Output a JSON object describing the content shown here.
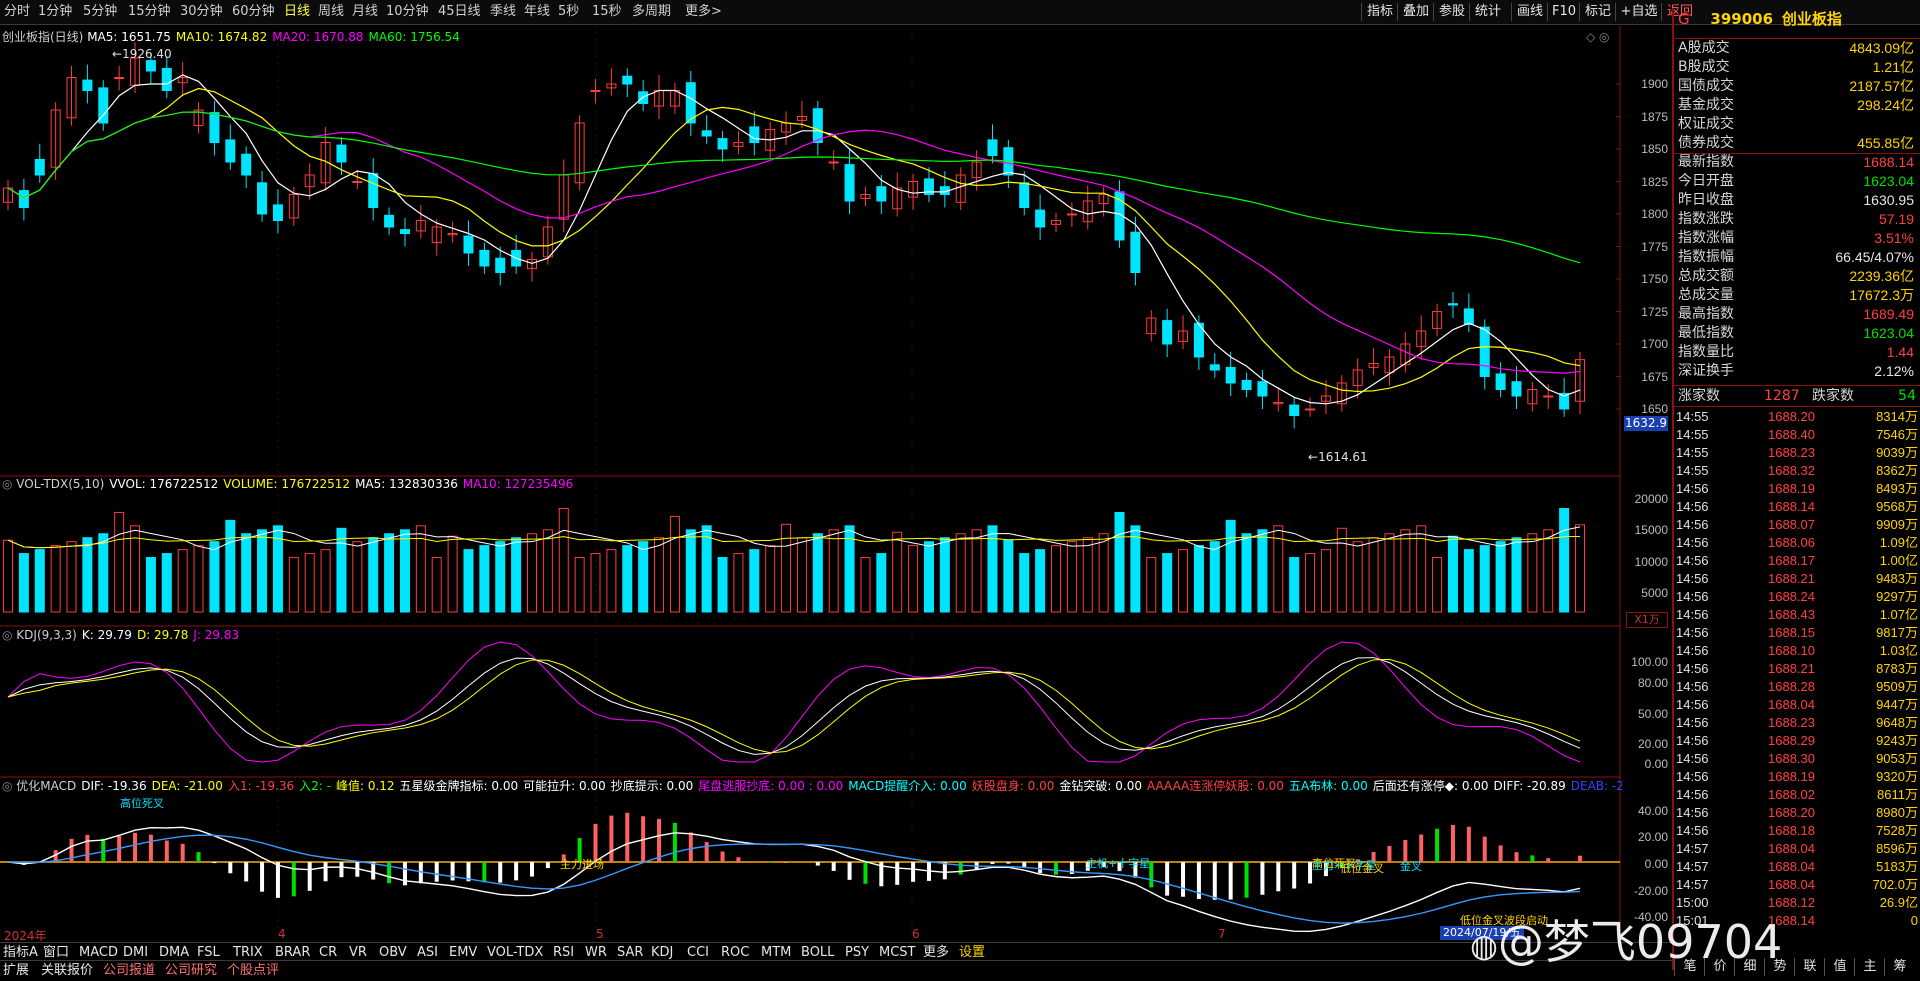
{
  "top_bar": {
    "timeframes": [
      "分时",
      "1分钟",
      "5分钟",
      "15分钟",
      "30分钟",
      "60分钟",
      "日线",
      "周线",
      "月线",
      "10分钟",
      "45日线",
      "季线",
      "年线",
      "5秒",
      "15秒",
      "多周期",
      "更多>"
    ],
    "active": "日线",
    "right_buttons": [
      "指标",
      "叠加",
      "参股",
      "统计",
      "画线",
      "F10",
      "标记",
      "+自选",
      "返回"
    ]
  },
  "main_panel": {
    "title": "创业板指(日线)",
    "ma_legend": [
      {
        "label": "MA5: 1651.75",
        "color": "#ffffff"
      },
      {
        "label": "MA10: 1674.82",
        "color": "#ffff00"
      },
      {
        "label": "MA20: 1670.88",
        "color": "#ff00ff"
      },
      {
        "label": "MA60: 1756.54",
        "color": "#00ff00"
      }
    ],
    "high_label": "1926.40",
    "low_label": "1614.61",
    "current_price_tag": "1632.9",
    "y_ticks": [
      "1900",
      "1875",
      "1850",
      "1825",
      "1800",
      "1775",
      "1750",
      "1725",
      "1700",
      "1675",
      "1650"
    ],
    "y_tick_values": [
      1900,
      1875,
      1850,
      1825,
      1800,
      1775,
      1750,
      1725,
      1700,
      1675,
      1650
    ]
  },
  "vol_panel": {
    "legend": [
      {
        "label": "VOL-TDX(5,10)",
        "color": "#cfcfcf"
      },
      {
        "label": "VVOL: 176722512",
        "color": "#ffffff"
      },
      {
        "label": "VOLUME: 176722512",
        "color": "#ffff00"
      },
      {
        "label": "MA5: 132830336",
        "color": "#ffffff"
      },
      {
        "label": "MA10: 127235496",
        "color": "#ff00ff"
      }
    ],
    "y_ticks": [
      "20000",
      "15000",
      "10000",
      "5000"
    ],
    "unit": "X1万"
  },
  "kdj_panel": {
    "legend": [
      {
        "label": "KDJ(9,3,3)",
        "color": "#cfcfcf"
      },
      {
        "label": "K: 29.79",
        "color": "#ffffff"
      },
      {
        "label": "D: 29.78",
        "color": "#ffff00"
      },
      {
        "label": "J: 29.83",
        "color": "#ff00ff"
      }
    ],
    "y_ticks": [
      "100.00",
      "80.00",
      "50.00",
      "20.00",
      "0.00"
    ]
  },
  "macd_panel": {
    "legend": [
      {
        "label": "优化MACD",
        "color": "#cfcfcf"
      },
      {
        "label": "DIF: -19.36",
        "color": "#ffffff"
      },
      {
        "label": "DEA: -21.00",
        "color": "#ffff00"
      },
      {
        "label": "入1: -19.36",
        "color": "#ff4040"
      },
      {
        "label": "入2: -",
        "color": "#00ff00"
      },
      {
        "label": "峰值: 0.12",
        "color": "#ffff00"
      },
      {
        "label": "五星级金牌指标: 0.00",
        "color": "#ffffff"
      },
      {
        "label": "可能拉升: 0.00",
        "color": "#ffffff"
      },
      {
        "label": "抄底提示: 0.00",
        "color": "#ffffff"
      },
      {
        "label": "尾盘逃服抄底: 0.00 : 0.00",
        "color": "#ff00ff"
      },
      {
        "label": "MACD提醒介入: 0.00",
        "color": "#00ffff"
      },
      {
        "label": "妖股盘身: 0.00",
        "color": "#ff4040"
      },
      {
        "label": "金钻突破: 0.00",
        "color": "#ffffff"
      },
      {
        "label": "AAAAA连涨停妖股: 0.00",
        "color": "#ff4040"
      },
      {
        "label": "五A布林: 0.00",
        "color": "#00ffff"
      },
      {
        "label": "后面还有涨停◆: 0.00",
        "color": "#ffffff"
      },
      {
        "label": "DIFF: -20.89",
        "color": "#ffffff"
      },
      {
        "label": "DEAB: -22.01",
        "color": "#3344ff"
      },
      {
        "label": ": -20.89 : 0.0",
        "color": "#ff4040"
      }
    ],
    "y_ticks": [
      "40.00",
      "20.00",
      "0.00",
      "-20.00",
      "-40.00"
    ],
    "annotations": [
      "高位死叉",
      "主力进场",
      "主机+十字星",
      "高位死叉",
      "主力+十字星",
      "低位金叉",
      "金叉",
      "低位金叉波段启动"
    ],
    "date_tag": "2024/07/19/五"
  },
  "x_axis": {
    "labels": [
      "2024年",
      "4",
      "5",
      "6",
      "7"
    ]
  },
  "right_panel": {
    "header_flag": "G",
    "code": "399006",
    "name": "创业板指",
    "stats": [
      {
        "k": "A股成交",
        "v": "4843.09亿",
        "c": "#ffd400"
      },
      {
        "k": "B股成交",
        "v": "1.21亿",
        "c": "#ffd400"
      },
      {
        "k": "国债成交",
        "v": "2187.57亿",
        "c": "#ffd400"
      },
      {
        "k": "基金成交",
        "v": "298.24亿",
        "c": "#ffd400"
      },
      {
        "k": "权证成交",
        "v": "",
        "c": "#ffd400"
      },
      {
        "k": "债券成交",
        "v": "455.85亿",
        "c": "#ffd400"
      },
      {
        "k": "最新指数",
        "v": "1688.14",
        "c": "#ff4040"
      },
      {
        "k": "今日开盘",
        "v": "1623.04",
        "c": "#00e000"
      },
      {
        "k": "昨日收盘",
        "v": "1630.95",
        "c": "#e6e6e6"
      },
      {
        "k": "指数涨跌",
        "v": "57.19",
        "c": "#ff4040"
      },
      {
        "k": "指数涨幅",
        "v": "3.51%",
        "c": "#ff4040"
      },
      {
        "k": "指数振幅",
        "v": "66.45/4.07%",
        "c": "#e6e6e6"
      },
      {
        "k": "总成交额",
        "v": "2239.36亿",
        "c": "#ffd400"
      },
      {
        "k": "总成交量",
        "v": "17672.3万",
        "c": "#ffd400"
      },
      {
        "k": "最高指数",
        "v": "1689.49",
        "c": "#ff4040"
      },
      {
        "k": "最低指数",
        "v": "1623.04",
        "c": "#00e000"
      },
      {
        "k": "指数量比",
        "v": "1.44",
        "c": "#ff4040"
      },
      {
        "k": "深证换手",
        "v": "2.12%",
        "c": "#e6e6e6"
      }
    ],
    "breadth": {
      "up_label": "涨家数",
      "up": "1287",
      "down_label": "跌家数",
      "down": "54"
    },
    "ticks": [
      {
        "t": "14:55",
        "p": "1688.20",
        "v": "8314万"
      },
      {
        "t": "14:55",
        "p": "1688.40",
        "v": "7546万"
      },
      {
        "t": "14:55",
        "p": "1688.23",
        "v": "9039万"
      },
      {
        "t": "14:55",
        "p": "1688.32",
        "v": "8362万"
      },
      {
        "t": "14:56",
        "p": "1688.19",
        "v": "8493万"
      },
      {
        "t": "14:56",
        "p": "1688.14",
        "v": "9568万"
      },
      {
        "t": "14:56",
        "p": "1688.07",
        "v": "9909万"
      },
      {
        "t": "14:56",
        "p": "1688.06",
        "v": "1.09亿"
      },
      {
        "t": "14:56",
        "p": "1688.17",
        "v": "1.00亿"
      },
      {
        "t": "14:56",
        "p": "1688.21",
        "v": "9483万"
      },
      {
        "t": "14:56",
        "p": "1688.24",
        "v": "9297万"
      },
      {
        "t": "14:56",
        "p": "1688.43",
        "v": "1.07亿"
      },
      {
        "t": "14:56",
        "p": "1688.15",
        "v": "9817万"
      },
      {
        "t": "14:56",
        "p": "1688.10",
        "v": "1.03亿"
      },
      {
        "t": "14:56",
        "p": "1688.21",
        "v": "8783万"
      },
      {
        "t": "14:56",
        "p": "1688.28",
        "v": "9509万"
      },
      {
        "t": "14:56",
        "p": "1688.04",
        "v": "9447万"
      },
      {
        "t": "14:56",
        "p": "1688.23",
        "v": "9648万"
      },
      {
        "t": "14:56",
        "p": "1688.29",
        "v": "9243万"
      },
      {
        "t": "14:56",
        "p": "1688.30",
        "v": "9053万"
      },
      {
        "t": "14:56",
        "p": "1688.19",
        "v": "9320万"
      },
      {
        "t": "14:56",
        "p": "1688.02",
        "v": "8611万"
      },
      {
        "t": "14:56",
        "p": "1688.20",
        "v": "8980万"
      },
      {
        "t": "14:56",
        "p": "1688.18",
        "v": "7528万"
      },
      {
        "t": "14:57",
        "p": "1688.04",
        "v": "8596万"
      },
      {
        "t": "14:57",
        "p": "1688.04",
        "v": "5183万"
      },
      {
        "t": "14:57",
        "p": "1688.04",
        "v": "702.0万"
      },
      {
        "t": "15:00",
        "p": "1688.12",
        "v": "26.9亿"
      },
      {
        "t": "15:01",
        "p": "1688.14",
        "v": "0"
      }
    ]
  },
  "indicator_tabs": [
    "指标A",
    "窗口",
    "MACD",
    "DMI",
    "DMA",
    "FSL",
    "TRIX",
    "BRAR",
    "CR",
    "VR",
    "OBV",
    "ASI",
    "EMV",
    "VOL-TDX",
    "RSI",
    "WR",
    "SAR",
    "KDJ",
    "CCI",
    "ROC",
    "MTM",
    "BOLL",
    "PSY",
    "MCST",
    "更多",
    "设置"
  ],
  "bottom_tabs": [
    "扩展",
    "关联报价",
    "公司报道",
    "公司研究",
    "个股点评"
  ],
  "right_bottom_tabs": [
    "笔",
    "价",
    "细",
    "势",
    "联",
    "值",
    "主",
    "筹"
  ],
  "watermark": "@梦飞09704",
  "colors": {
    "up": "#ff3b3b",
    "down": "#00e5ff",
    "ma5": "#ffffff",
    "ma10": "#ffff00",
    "ma20": "#ff00ff",
    "ma60": "#00ff00",
    "grid": "#8a1010"
  }
}
